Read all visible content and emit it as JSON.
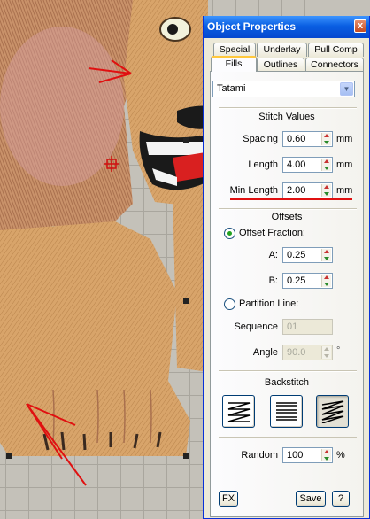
{
  "dialog": {
    "title": "Object Properties",
    "close_glyph": "x",
    "tabs_row1": [
      "Special",
      "Underlay",
      "Pull Comp"
    ],
    "tabs_row2": [
      "Fills",
      "Outlines",
      "Connectors"
    ],
    "active_tab": "Fills",
    "fill_type": "Tatami",
    "stitch_values": {
      "title": "Stitch Values",
      "spacing": {
        "label": "Spacing",
        "value": "0.60",
        "unit": "mm"
      },
      "length": {
        "label": "Length",
        "value": "4.00",
        "unit": "mm"
      },
      "min_length": {
        "label": "Min Length",
        "value": "2.00",
        "unit": "mm"
      }
    },
    "offsets": {
      "title": "Offsets",
      "offset_fraction": {
        "label": "Offset Fraction:",
        "checked": true
      },
      "a": {
        "label": "A:",
        "value": "0.25"
      },
      "b": {
        "label": "B:",
        "value": "0.25"
      },
      "partition_line": {
        "label": "Partition Line:",
        "checked": false
      },
      "sequence": {
        "label": "Sequence",
        "value": "01"
      },
      "angle": {
        "label": "Angle",
        "value": "90.0",
        "unit": "°"
      }
    },
    "backstitch": {
      "title": "Backstitch",
      "buttons": [
        "backstitch-zigzag-icon",
        "backstitch-parallel-icon",
        "backstitch-diagonal-icon"
      ],
      "selected_index": 2
    },
    "random": {
      "label": "Random",
      "value": "100",
      "unit": "%"
    },
    "footer": {
      "fx": "FX",
      "save": "Save",
      "help": "?"
    }
  },
  "colors": {
    "titlebar": "#0a5fe2",
    "annotation_red": "#e01010",
    "fabric": "#d8a46a"
  }
}
